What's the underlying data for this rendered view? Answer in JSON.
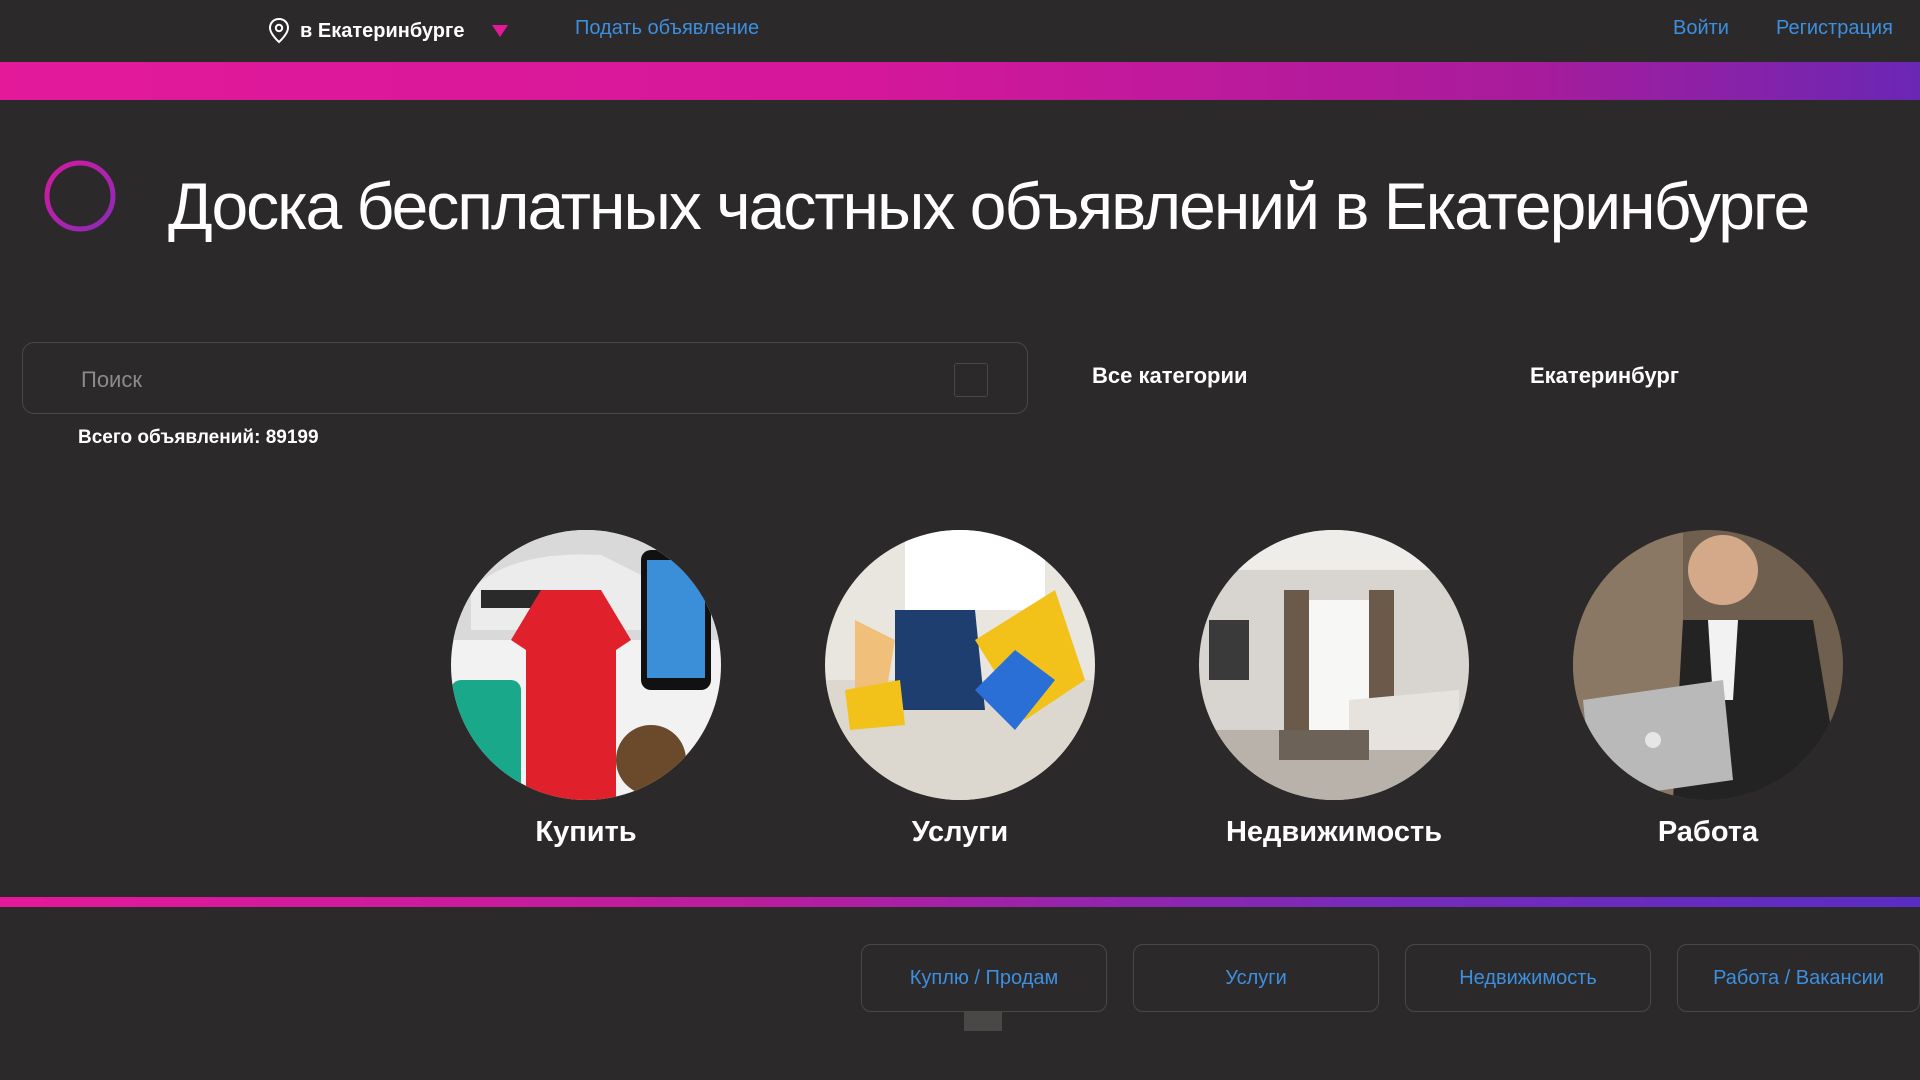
{
  "header": {
    "location_label": "в Екатеринбурге",
    "post_ad": "Подать объявление",
    "login": "Войти",
    "register": "Регистрация"
  },
  "main": {
    "title": "Доска бесплатных частных объявлений в Екатеринбурге",
    "search": {
      "placeholder": "Поиск",
      "value": ""
    },
    "category_select": "Все категории",
    "city_select": "Екатеринбург",
    "total": "Всего объявлений: 89199"
  },
  "categories": [
    {
      "label": "Купить",
      "icon": "shopping-image"
    },
    {
      "label": "Услуги",
      "icon": "cleaning-image"
    },
    {
      "label": "Недвижимость",
      "icon": "interior-image"
    },
    {
      "label": "Работа",
      "icon": "office-worker-image"
    }
  ],
  "footer_nav": [
    {
      "label": "Куплю / Продам"
    },
    {
      "label": "Услуги"
    },
    {
      "label": "Недвижимость"
    },
    {
      "label": "Работа / Вакансии"
    }
  ],
  "colors": {
    "background": "#2b2929",
    "link": "#3d8fe0",
    "accent_pink": "#e3199a",
    "accent_purple": "#6a27b4"
  }
}
